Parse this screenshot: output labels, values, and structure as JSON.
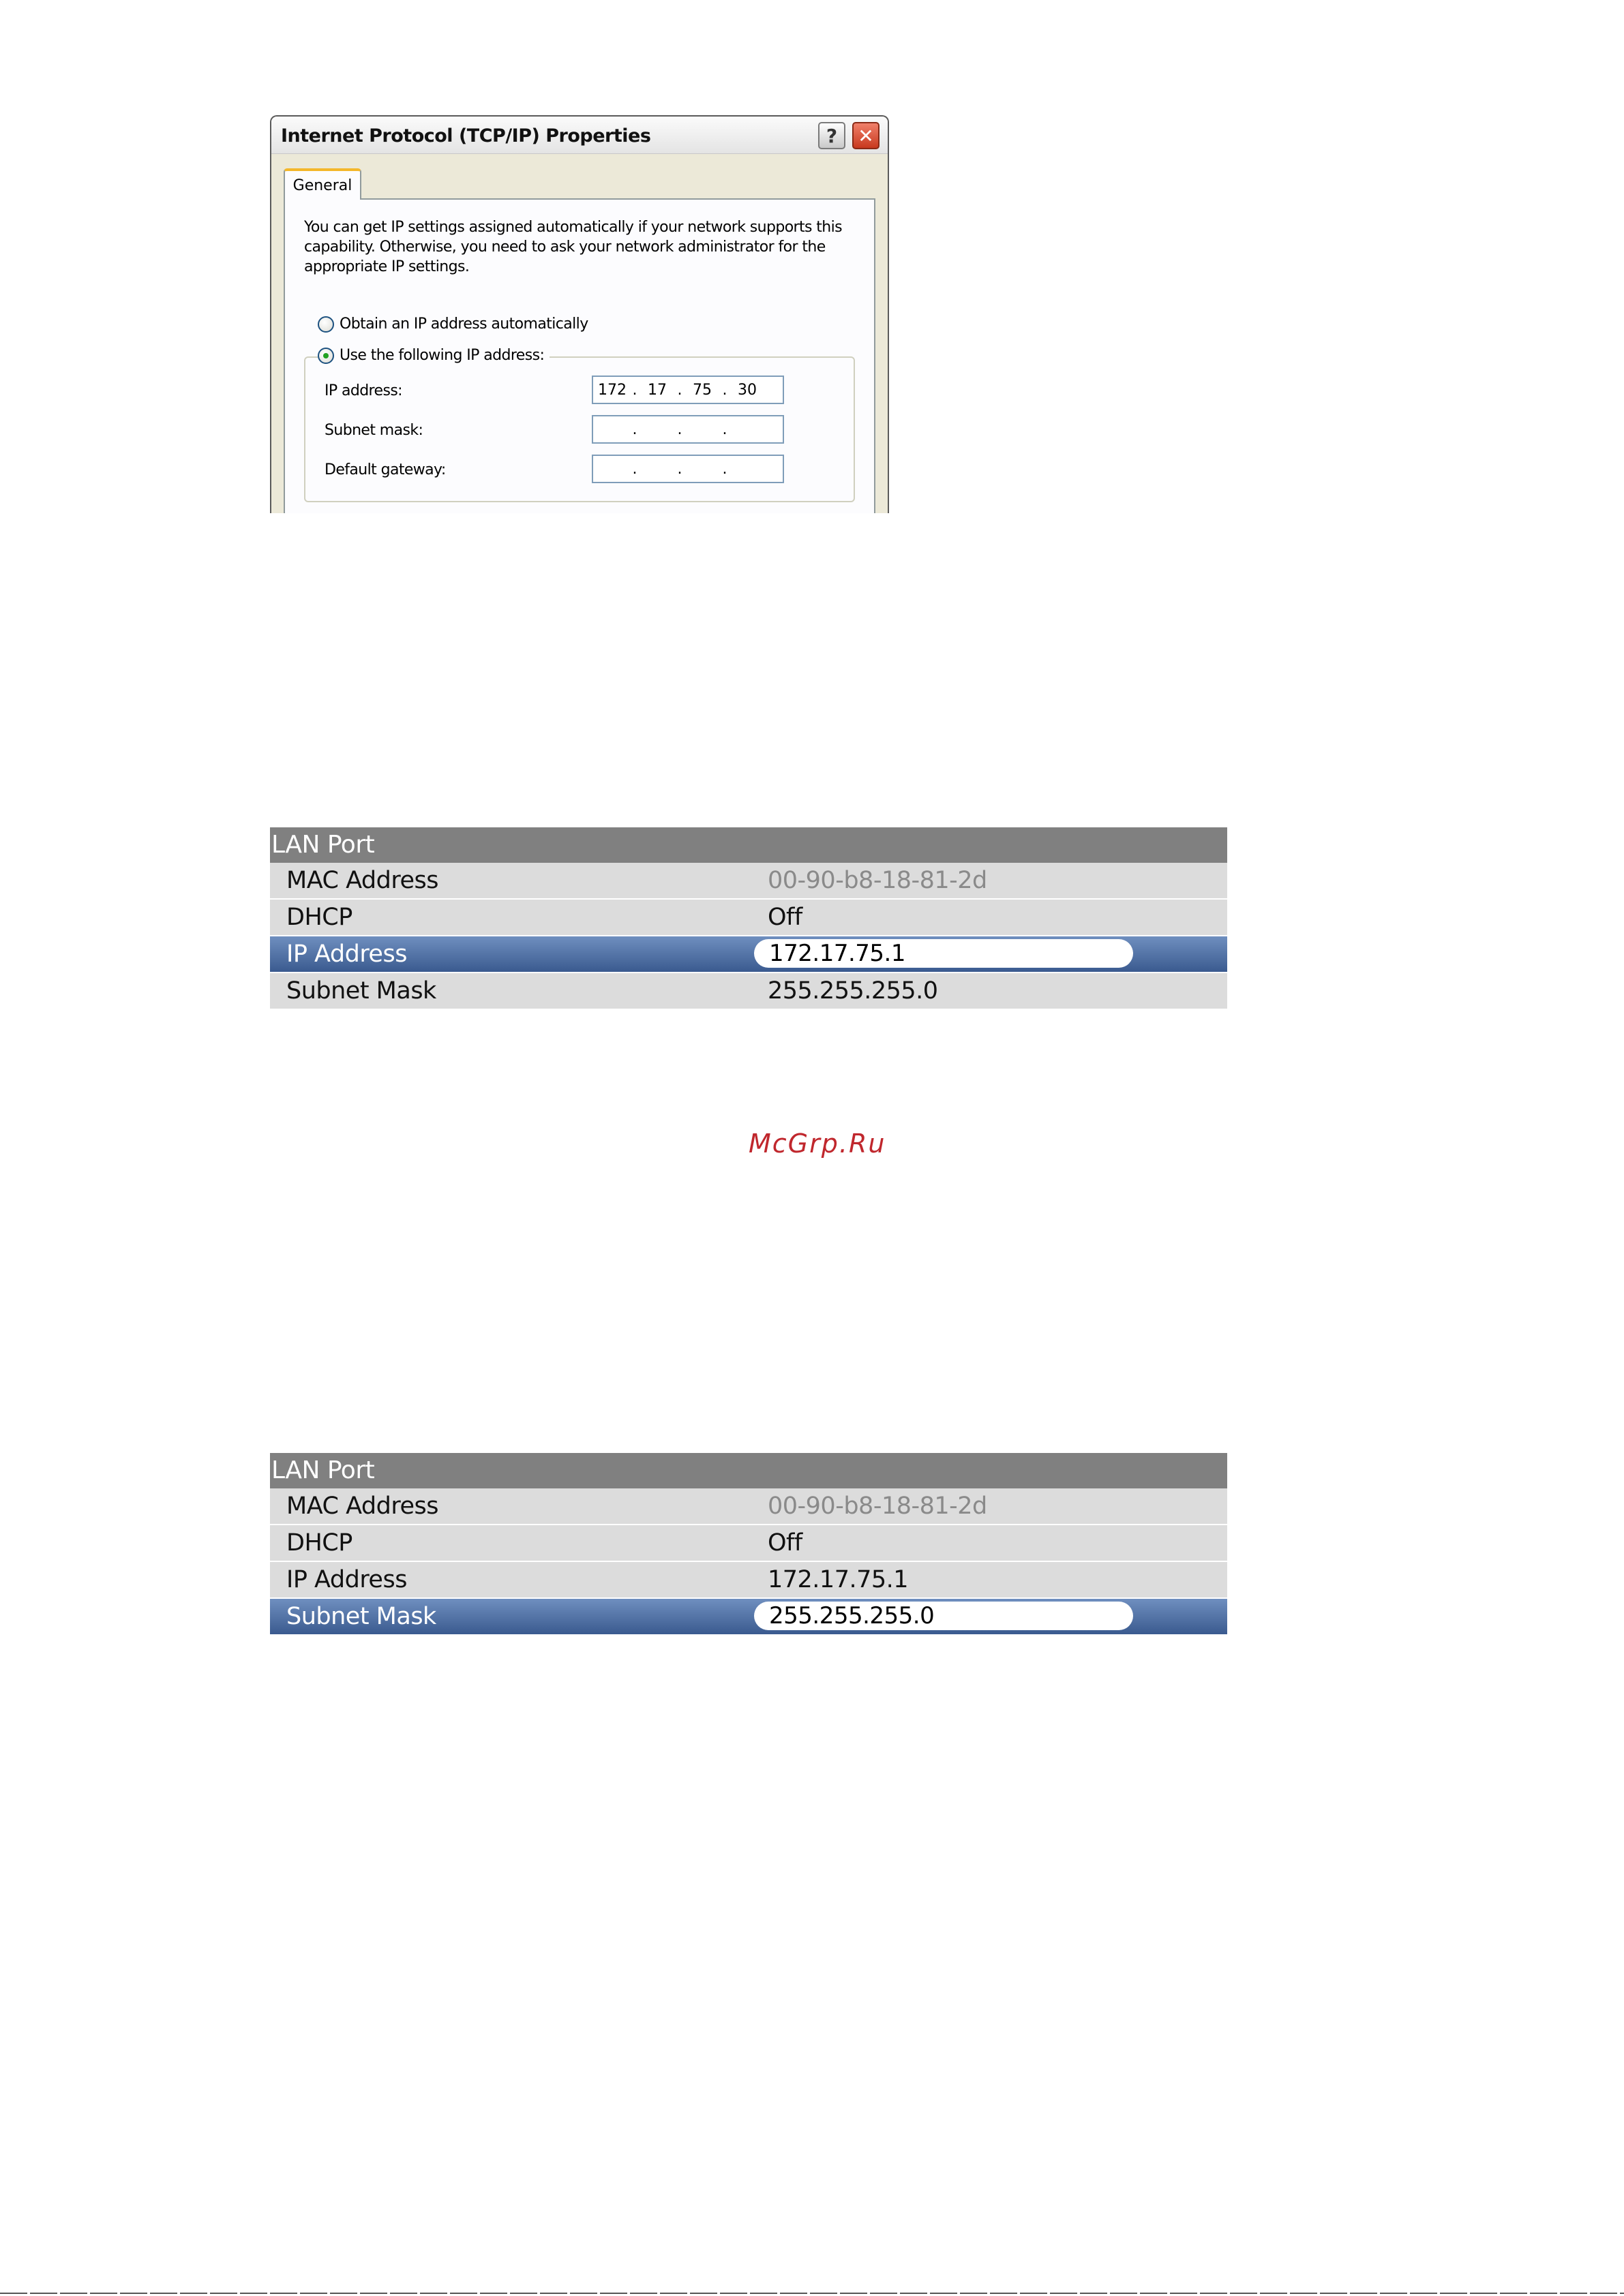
{
  "dialog": {
    "title": "Internet Protocol (TCP/IP) Properties",
    "help_glyph": "?",
    "close_glyph": "✕",
    "tab_general": "General",
    "intro_text": "You can get IP settings assigned automatically if your network supports this capability. Otherwise, you need to ask your network administrator for the appropriate IP settings.",
    "radio_auto": "Obtain an IP address automatically",
    "radio_manual": "Use the following IP address:",
    "radio_selected": "manual",
    "fields": {
      "ip_label": "IP address:",
      "ip_octets": [
        "172",
        "17",
        "75",
        "30"
      ],
      "subnet_label": "Subnet mask:",
      "gateway_label": "Default gateway:",
      "separator": "."
    }
  },
  "lan_tables": [
    {
      "header": "LAN Port",
      "rows": [
        {
          "key": "MAC Address",
          "value": "00-90-b8-18-81-2d"
        },
        {
          "key": "DHCP",
          "value": "Off"
        },
        {
          "key": "IP Address",
          "value": "172.17.75.1"
        },
        {
          "key": "Subnet Mask",
          "value": "255.255.255.0"
        }
      ],
      "selected_row": "IP Address"
    },
    {
      "header": "LAN Port",
      "rows": [
        {
          "key": "MAC Address",
          "value": "00-90-b8-18-81-2d"
        },
        {
          "key": "DHCP",
          "value": "Off"
        },
        {
          "key": "IP Address",
          "value": "172.17.75.1"
        },
        {
          "key": "Subnet Mask",
          "value": "255.255.255.0"
        }
      ],
      "selected_row": "Subnet Mask"
    }
  ],
  "watermark": "McGrp.Ru",
  "colors": {
    "selected_row": "#3a5a8f",
    "header_bg": "#808080",
    "muted_value": "#8a8a8a",
    "watermark": "#c0272d"
  }
}
